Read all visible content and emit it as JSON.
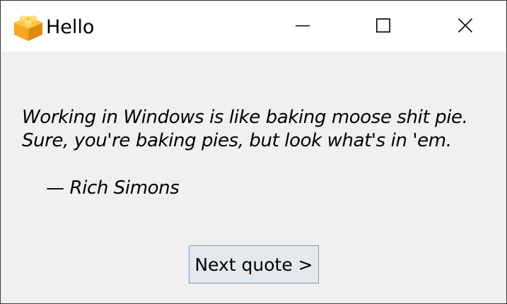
{
  "window": {
    "title": "Hello",
    "app_icon": "lego-brick-icon",
    "controls": {
      "minimize_icon": "minimize-icon",
      "maximize_icon": "maximize-icon",
      "close_icon": "close-icon"
    }
  },
  "quote": {
    "text": "Working in Windows is like baking moose shit pie. Sure, you're baking pies, but look what's in 'em.",
    "author": "— Rich Simons"
  },
  "actions": {
    "next_label": "Next quote >"
  },
  "colors": {
    "titlebar": "#ffffff",
    "content_background": "#f0f0f0",
    "button_background": "#e5e9ee",
    "button_border": "#7a9ebe",
    "icon_orange": "#f5a623"
  }
}
